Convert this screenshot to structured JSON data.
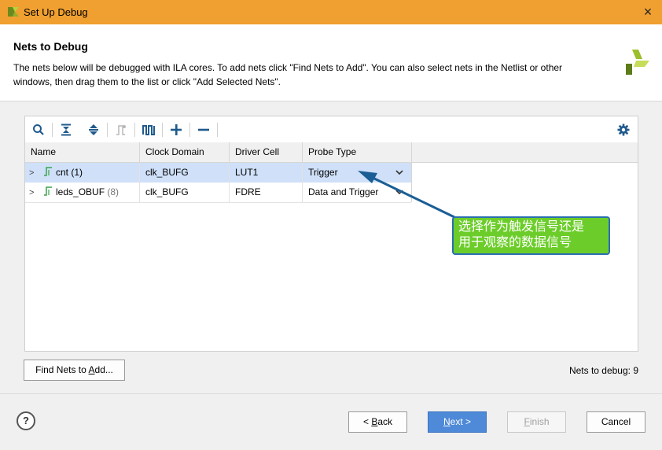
{
  "window": {
    "title": "Set Up Debug",
    "close_glyph": "×"
  },
  "header": {
    "title": "Nets to Debug",
    "description": "The nets below will be debugged with ILA cores. To add nets click \"Find Nets to Add\". You can also select nets in the Netlist or other windows, then drag them to the list or click \"Add Selected Nets\"."
  },
  "toolbar": {
    "icons": [
      "search-icon",
      "collapse-all-icon",
      "expand-all-icon",
      "schematic-icon",
      "waveform-icon",
      "add-icon",
      "remove-icon",
      "gear-icon"
    ]
  },
  "table": {
    "columns": [
      "Name",
      "Clock Domain",
      "Driver Cell",
      "Probe Type"
    ],
    "rows": [
      {
        "name": "cnt",
        "count": "(1)",
        "clock_domain": "clk_BUFG",
        "driver_cell": "LUT1",
        "probe_type": "Trigger",
        "selected": true
      },
      {
        "name": "leds_OBUF",
        "count": "(8)",
        "clock_domain": "clk_BUFG",
        "driver_cell": "FDRE",
        "probe_type": "Data and Trigger",
        "selected": false
      }
    ]
  },
  "find_nets_button": {
    "prefix": "Find Nets to ",
    "mnemonic": "A",
    "suffix": "dd..."
  },
  "status": {
    "text": "Nets to debug: 9"
  },
  "annotation": {
    "line1": "选择作为触发信号还是",
    "line2": "用于观察的数据信号"
  },
  "buttons": {
    "back": {
      "prefix": "< ",
      "mnemonic": "B",
      "suffix": "ack"
    },
    "next": {
      "mnemonic": "N",
      "suffix": "ext >"
    },
    "finish": {
      "mnemonic": "F",
      "suffix": "inish"
    },
    "cancel": "Cancel"
  },
  "colors": {
    "title_bar": "#f0a030",
    "selection": "#cfe0f8",
    "primary_button": "#4e8ad8",
    "callout_fill": "#6ccd2a",
    "callout_border": "#2a6eb0"
  }
}
